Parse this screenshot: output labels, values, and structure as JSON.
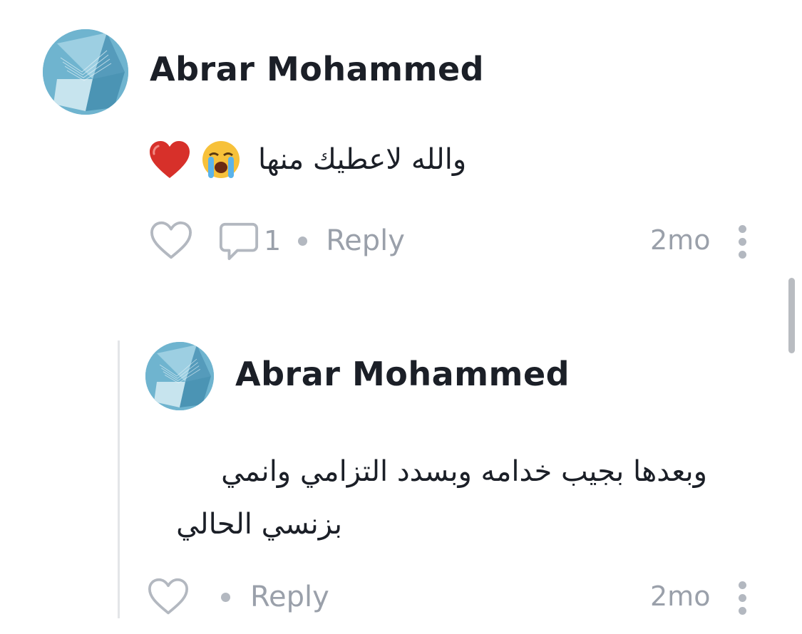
{
  "comments": [
    {
      "author": "Abrar Mohammed",
      "text": "والله لاعطيك منها",
      "emojis": [
        "crying-face",
        "red-heart"
      ],
      "reply_count": "1",
      "reply_label": "Reply",
      "time": "2mo"
    },
    {
      "author": "Abrar Mohammed",
      "text_line1": "وبعدها بجيب خدامه وبسدد التزامي وانمي",
      "text_line2": "بزنسي الحالي",
      "reply_label": "Reply",
      "time": "2mo"
    }
  ],
  "colors": {
    "text": "#1b1f27",
    "muted": "#9aa0aa",
    "dot": "#b3b8c0",
    "thread_line": "#e3e5e8",
    "avatar": "#6fb4cf"
  },
  "icons": {
    "like": "heart-outline-icon",
    "reply_count": "speech-bubble-icon",
    "more": "vertical-ellipsis-icon"
  }
}
